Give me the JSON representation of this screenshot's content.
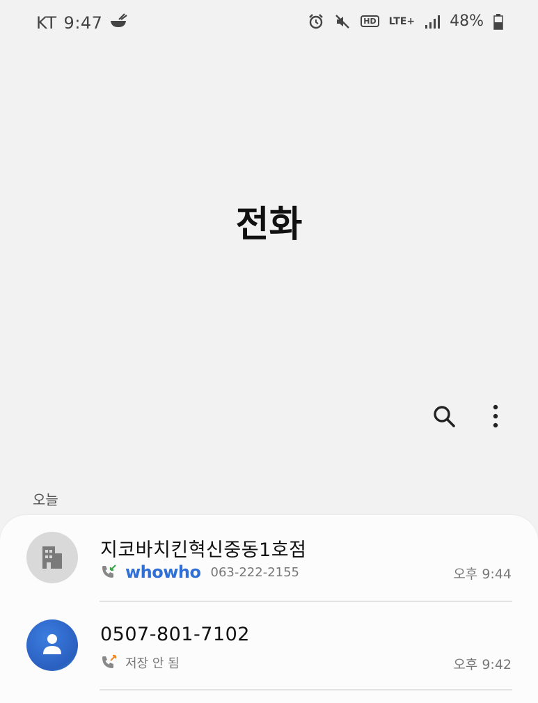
{
  "status_bar": {
    "carrier": "KT",
    "time": "9:47",
    "hd_label": "HD",
    "network": "LTE+",
    "battery": "48%"
  },
  "header": {
    "title": "전화"
  },
  "section": {
    "label": "오늘"
  },
  "calls": [
    {
      "name": "지코바치킨혁신중동1호점",
      "call_type": "incoming",
      "provider": "whowho",
      "number": "063-222-2155",
      "time": "오후 9:44"
    },
    {
      "name": "0507-801-7102",
      "call_type": "outgoing",
      "note": "저장 안 됨",
      "time": "오후 9:42"
    }
  ],
  "colors": {
    "background": "#f2f2f2",
    "card": "#fcfcfc",
    "whowho_blue": "#2f6fd6",
    "incoming_green": "#3aa64a",
    "outgoing_orange": "#f08a2a"
  }
}
